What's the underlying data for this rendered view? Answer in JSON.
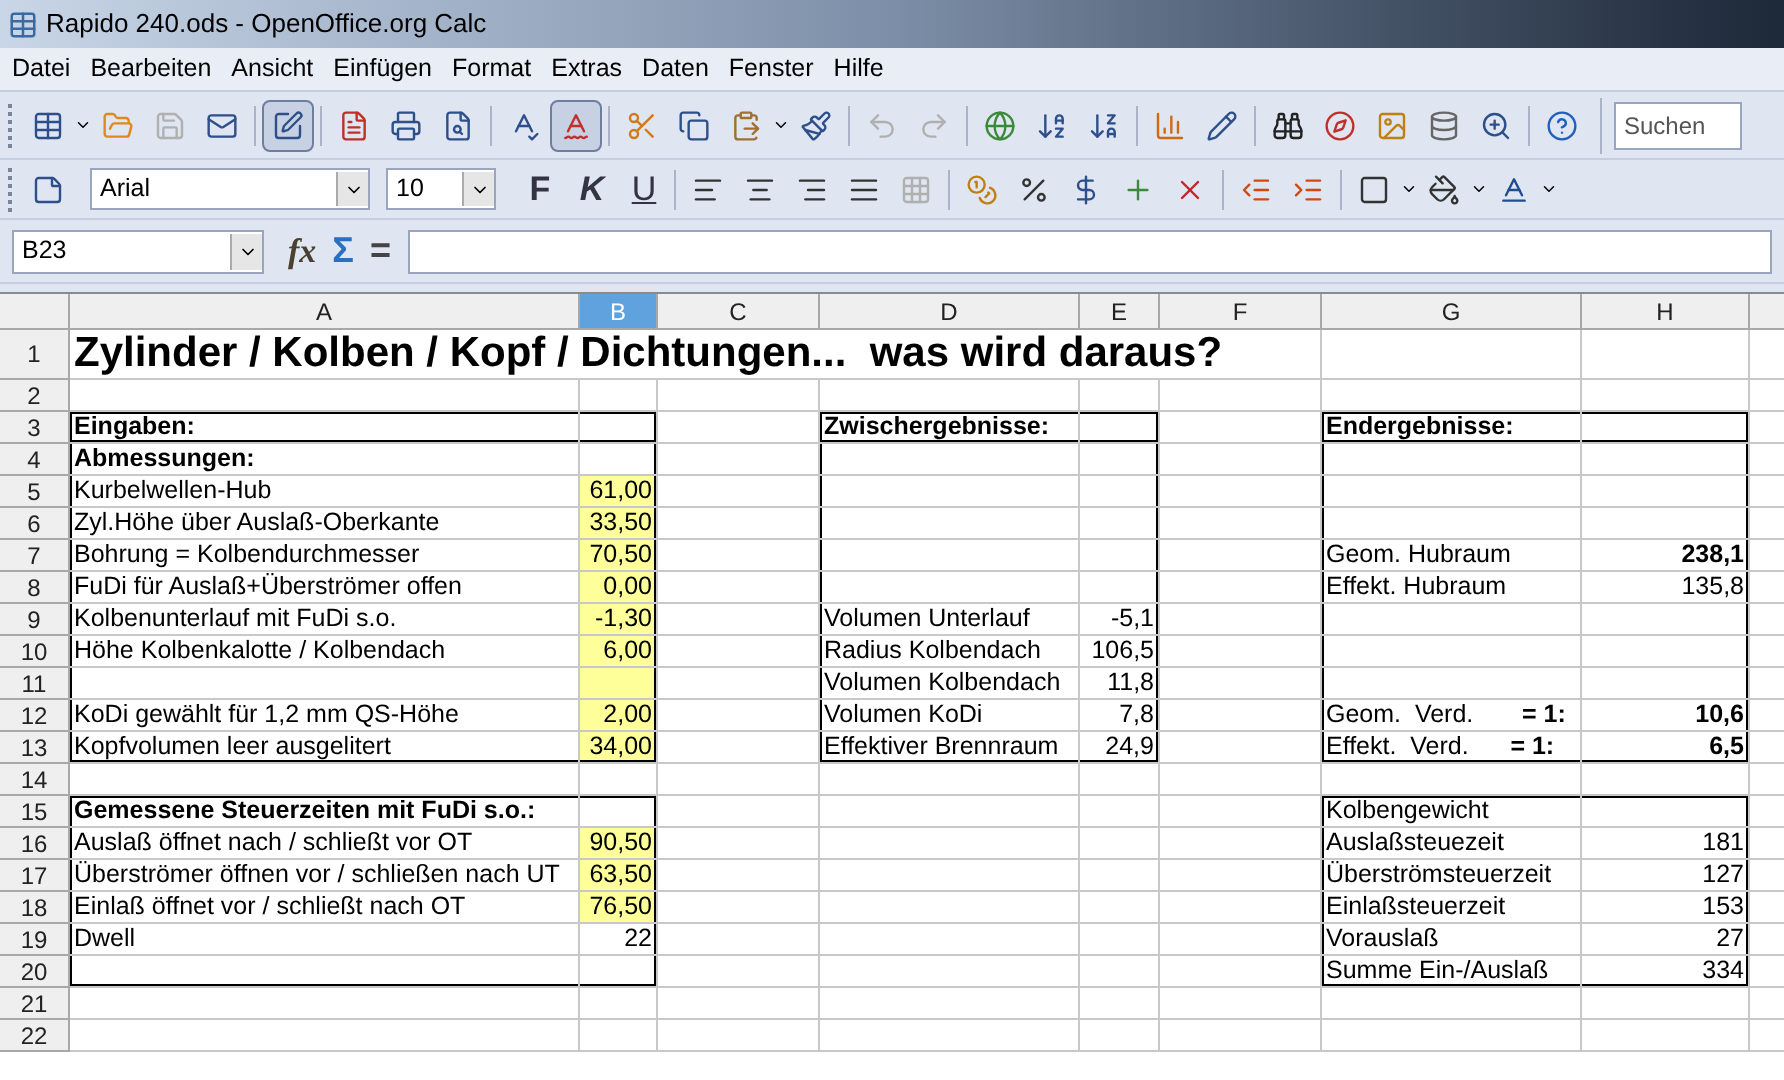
{
  "window": {
    "title": "Rapido 240.ods - OpenOffice.org Calc"
  },
  "menu": [
    "Datei",
    "Bearbeiten",
    "Ansicht",
    "Einfügen",
    "Format",
    "Extras",
    "Daten",
    "Fenster",
    "Hilfe"
  ],
  "standard_toolbar": {
    "edit_file": {
      "pressed": true
    },
    "autospellcheck": {
      "pressed": true
    },
    "undo": {
      "disabled": true
    },
    "redo": {
      "disabled": true
    },
    "search": {
      "placeholder": "Suchen"
    }
  },
  "formatting_toolbar": {
    "font_name": "Arial",
    "font_size": "10",
    "bold": "F",
    "italic": "K",
    "underline": "U"
  },
  "formula_bar": {
    "name_box": "B23",
    "function_wizard": "fx",
    "sum": "Σ",
    "equals": "="
  },
  "columns": [
    {
      "label": "A",
      "selected": false
    },
    {
      "label": "B",
      "selected": true
    },
    {
      "label": "C",
      "selected": false
    },
    {
      "label": "D",
      "selected": false
    },
    {
      "label": "E",
      "selected": false
    },
    {
      "label": "F",
      "selected": false
    },
    {
      "label": "G",
      "selected": false
    },
    {
      "label": "H",
      "selected": false
    }
  ],
  "rows": [
    {
      "number": "1",
      "cells": {
        "A": {
          "kind": "title",
          "text": "Zylinder / Kolben / Kopf / Dichtungen...  was wird daraus?"
        }
      }
    },
    {
      "number": "2",
      "cells": {}
    },
    {
      "number": "3",
      "cells": {
        "A": {
          "kind": "heading",
          "text": "Eingaben:"
        },
        "D": {
          "kind": "heading",
          "text": "Zwischergebnisse:"
        },
        "G": {
          "kind": "heading",
          "text": "Endergebnisse:"
        }
      }
    },
    {
      "number": "4",
      "cells": {
        "A": {
          "kind": "heading",
          "text": "Abmessungen:"
        }
      }
    },
    {
      "number": "5",
      "cells": {
        "A": {
          "kind": "label",
          "text": "Kurbelwellen-Hub"
        },
        "B": {
          "kind": "input",
          "text": "61,00"
        }
      }
    },
    {
      "number": "6",
      "cells": {
        "A": {
          "kind": "label",
          "text": "Zyl.Höhe über Auslaß-Oberkante"
        },
        "B": {
          "kind": "input",
          "text": "33,50"
        }
      }
    },
    {
      "number": "7",
      "cells": {
        "A": {
          "kind": "label",
          "text": "Bohrung = Kolbendurchmesser"
        },
        "B": {
          "kind": "input",
          "text": "70,50"
        },
        "G": {
          "kind": "label",
          "text": "Geom. Hubraum"
        },
        "H": {
          "kind": "result",
          "text": "238,1"
        }
      }
    },
    {
      "number": "8",
      "cells": {
        "A": {
          "kind": "label",
          "text": "FuDi für Auslaß+Überströmer offen"
        },
        "B": {
          "kind": "input",
          "text": "0,00"
        },
        "G": {
          "kind": "label",
          "text": "Effekt. Hubraum"
        },
        "H": {
          "kind": "number",
          "text": "135,8"
        }
      }
    },
    {
      "number": "9",
      "cells": {
        "A": {
          "kind": "label",
          "text": "Kolbenunterlauf mit FuDi s.o."
        },
        "B": {
          "kind": "input",
          "text": "-1,30"
        },
        "D": {
          "kind": "label",
          "text": "Volumen Unterlauf"
        },
        "E": {
          "kind": "number",
          "text": "-5,1"
        }
      }
    },
    {
      "number": "10",
      "cells": {
        "A": {
          "kind": "label",
          "text": "Höhe Kolbenkalotte / Kolbendach"
        },
        "B": {
          "kind": "input",
          "text": "6,00"
        },
        "D": {
          "kind": "label",
          "text": "Radius Kolbendach"
        },
        "E": {
          "kind": "number",
          "text": "106,5"
        }
      }
    },
    {
      "number": "11",
      "cells": {
        "B": {
          "kind": "input"
        },
        "D": {
          "kind": "label",
          "text": "Volumen Kolbendach"
        },
        "E": {
          "kind": "number",
          "text": "11,8"
        }
      }
    },
    {
      "number": "12",
      "cells": {
        "A": {
          "kind": "label",
          "text": "KoDi gewählt für 1,2 mm QS-Höhe"
        },
        "B": {
          "kind": "input",
          "text": "2,00"
        },
        "D": {
          "kind": "label",
          "text": "Volumen KoDi"
        },
        "E": {
          "kind": "number",
          "text": "7,8"
        },
        "G": {
          "kind": "label",
          "text": "Geom.  Verd.       **= 1:**"
        },
        "H": {
          "kind": "result",
          "text": "10,6"
        }
      }
    },
    {
      "number": "13",
      "cells": {
        "A": {
          "kind": "label",
          "text": "Kopfvolumen leer ausgelitert"
        },
        "B": {
          "kind": "input",
          "text": "34,00"
        },
        "D": {
          "kind": "label",
          "text": "Effektiver Brennraum"
        },
        "E": {
          "kind": "number",
          "text": "24,9"
        },
        "G": {
          "kind": "label",
          "text": "Effekt.  Verd.      **= 1:**"
        },
        "H": {
          "kind": "result",
          "text": "6,5"
        }
      }
    },
    {
      "number": "14",
      "cells": {}
    },
    {
      "number": "15",
      "cells": {
        "A": {
          "kind": "heading",
          "text": "Gemessene Steuerzeiten mit FuDi s.o.:"
        },
        "G": {
          "kind": "label",
          "text": "Kolbengewicht"
        }
      }
    },
    {
      "number": "16",
      "cells": {
        "A": {
          "kind": "label",
          "text": "Auslaß öffnet nach / schließt vor OT"
        },
        "B": {
          "kind": "input",
          "text": "90,50"
        },
        "G": {
          "kind": "label",
          "text": "Auslaßsteuezeit"
        },
        "H": {
          "kind": "number",
          "text": "181"
        }
      }
    },
    {
      "number": "17",
      "cells": {
        "A": {
          "kind": "label",
          "text": "Überströmer öffnen vor / schließen nach UT"
        },
        "B": {
          "kind": "input",
          "text": "63,50"
        },
        "G": {
          "kind": "label",
          "text": "Überströmsteuerzeit"
        },
        "H": {
          "kind": "number",
          "text": "127"
        }
      }
    },
    {
      "number": "18",
      "cells": {
        "A": {
          "kind": "label",
          "text": "Einlaß öffnet vor / schließt nach OT"
        },
        "B": {
          "kind": "input",
          "text": "76,50"
        },
        "G": {
          "kind": "label",
          "text": "Einlaßsteuerzeit"
        },
        "H": {
          "kind": "number",
          "text": "153"
        }
      }
    },
    {
      "number": "19",
      "cells": {
        "A": {
          "kind": "label",
          "text": "Dwell"
        },
        "B": {
          "kind": "number",
          "text": "22"
        },
        "G": {
          "kind": "label",
          "text": "Vorauslaß"
        },
        "H": {
          "kind": "number",
          "text": "27"
        }
      }
    },
    {
      "number": "20",
      "cells": {
        "G": {
          "kind": "label",
          "text": "Summe Ein-/Auslaß"
        },
        "H": {
          "kind": "number",
          "text": "334"
        }
      }
    },
    {
      "number": "21",
      "cells": {}
    },
    {
      "number": "22",
      "cells": {}
    }
  ]
}
